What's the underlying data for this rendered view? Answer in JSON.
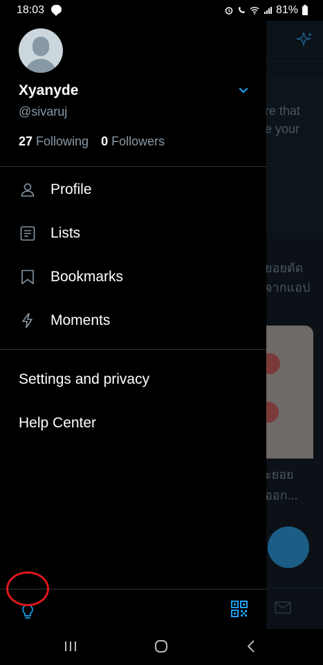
{
  "status_bar": {
    "time": "18:03",
    "battery": "81%",
    "icons": [
      "chat-icon",
      "alarm-icon",
      "wifi-call-icon",
      "wifi-icon",
      "signal-icon",
      "battery-icon"
    ]
  },
  "profile": {
    "name": "Xyanyde",
    "handle": "@sivaruj",
    "following_count": "27",
    "following_label": "Following",
    "followers_count": "0",
    "followers_label": "Followers"
  },
  "menu": [
    {
      "label": "Profile",
      "icon": "person-icon"
    },
    {
      "label": "Lists",
      "icon": "lists-icon"
    },
    {
      "label": "Bookmarks",
      "icon": "bookmark-icon"
    },
    {
      "label": "Moments",
      "icon": "lightning-icon"
    }
  ],
  "secondary_menu": [
    "Settings and privacy",
    "Help Center"
  ],
  "footer": {
    "left_icon": "lightbulb-icon",
    "right_icon": "qr-code-icon"
  },
  "background": {
    "text_lines_1": [
      "re that",
      "e your"
    ],
    "text_lines_2": [
      "ยอยตัด",
      "จากแอป"
    ],
    "text_lines_3": [
      "ะยอย",
      "ออก..."
    ]
  },
  "colors": {
    "accent": "#1da1f2",
    "highlight": "#e0171e",
    "muted": "#8899a6"
  }
}
